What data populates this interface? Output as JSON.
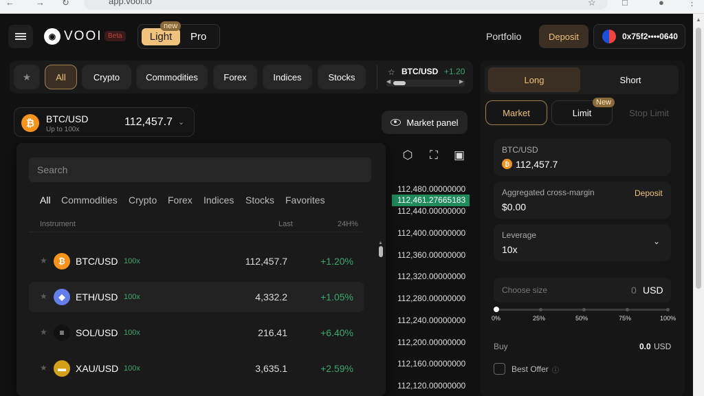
{
  "browser": {
    "url": "app.vooi.io"
  },
  "header": {
    "logo": "VOOI",
    "beta": "Beta",
    "mode_light": "Light",
    "mode_pro": "Pro",
    "mode_new_badge": "new",
    "portfolio": "Portfolio",
    "deposit": "Deposit",
    "wallet": "0x75f2••••0640"
  },
  "filters": {
    "chips": [
      "All",
      "Crypto",
      "Commodities",
      "Forex",
      "Indices",
      "Stocks"
    ],
    "active": "All"
  },
  "ticker": {
    "symbol": "BTC/USD",
    "change": "+1.20"
  },
  "selector": {
    "symbol": "BTC/USD",
    "leverage": "Up to 100x",
    "price": "112,457.7"
  },
  "market_panel": "Market panel",
  "dropdown": {
    "search_placeholder": "Search",
    "categories": [
      "All",
      "Commodities",
      "Crypto",
      "Forex",
      "Indices",
      "Stocks",
      "Favorites"
    ],
    "headers": {
      "instrument": "Instrument",
      "last": "Last",
      "change": "24H%"
    },
    "rows": [
      {
        "symbol": "BTC/USD",
        "leverage": "100x",
        "last": "112,457.7",
        "change": "+1.20%",
        "icon": "bitcoin-icon",
        "color": "#f7931a",
        "glyph": "₿"
      },
      {
        "symbol": "ETH/USD",
        "leverage": "100x",
        "last": "4,332.2",
        "change": "+1.05%",
        "icon": "ethereum-icon",
        "color": "#627eea",
        "glyph": "◆"
      },
      {
        "symbol": "SOL/USD",
        "leverage": "100x",
        "last": "216.41",
        "change": "+6.40%",
        "icon": "solana-icon",
        "color": "#111111",
        "glyph": "≡"
      },
      {
        "symbol": "XAU/USD",
        "leverage": "100x",
        "last": "3,635.1",
        "change": "+2.59%",
        "icon": "gold-icon",
        "color": "#d4a017",
        "glyph": "▬"
      }
    ]
  },
  "price_axis": {
    "labels": [
      "112,480.00000000",
      "112,440.00000000",
      "112,400.00000000",
      "112,360.00000000",
      "112,320.00000000",
      "112,280.00000000",
      "112,240.00000000",
      "112,200.00000000",
      "112,160.00000000",
      "112,120.00000000"
    ],
    "current": "112,461.27665183"
  },
  "order": {
    "long": "Long",
    "short": "Short",
    "types": [
      "Market",
      "Limit",
      "Stop Limit"
    ],
    "new_badge": "New",
    "pair_label": "BTC/USD",
    "pair_price": "112,457.7",
    "margin_label": "Aggregated cross-margin",
    "margin_value": "$0.00",
    "margin_deposit": "Deposit",
    "leverage_label": "Leverage",
    "leverage_value": "10x",
    "size_placeholder": "Choose size",
    "size_value": "0",
    "size_unit": "USD",
    "slider_value": 0,
    "slider_marks": [
      "0%",
      "25%",
      "50%",
      "75%",
      "100%"
    ],
    "buy_label": "Buy",
    "buy_value": "0.0",
    "buy_unit": "USD",
    "best_offer": "Best Offer"
  }
}
